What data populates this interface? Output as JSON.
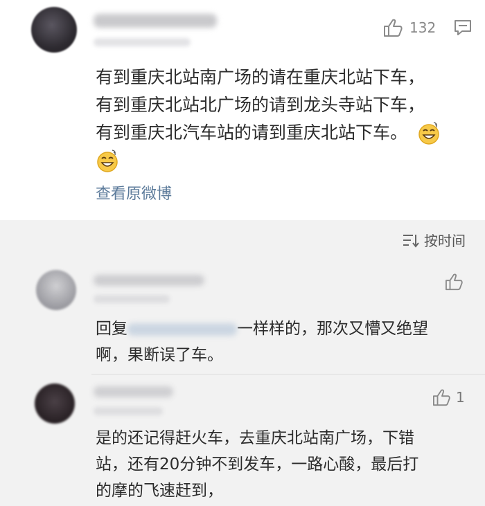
{
  "post": {
    "like_count": "132",
    "lines": [
      "有到重庆北站南广场的请在重庆北站下车，",
      "有到重庆北站北广场的请到龙头寺站下车，",
      "有到重庆北汽车站的请到重庆北站下车。"
    ],
    "view_original": "查看原微博"
  },
  "sort": {
    "label": "按时间"
  },
  "comments": [
    {
      "text_prefix": "回复",
      "text_rest": "一样样的，那次又懵又绝望",
      "text_line2": "啊，果断误了车。",
      "like_count": ""
    },
    {
      "line1": "是的还记得赶火车，去重庆北站南广场，下错",
      "line2": "站，还有20分钟不到发车，一路心酸，最后打",
      "line3": "的摩的飞速赶到，",
      "like_count": "1"
    }
  ],
  "icons": [
    "thumbs-up-icon",
    "comment-icon",
    "grin-emoji-icon",
    "sort-icon"
  ],
  "colors": {
    "link": "#5b7a9a",
    "background_comments": "#f2f2f2"
  }
}
